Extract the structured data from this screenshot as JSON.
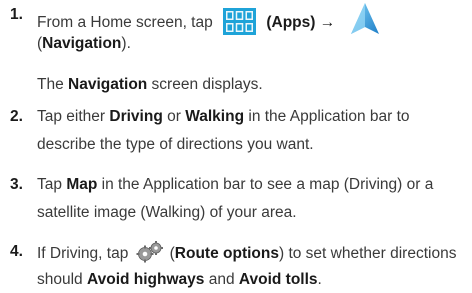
{
  "steps": [
    {
      "number": "1.",
      "line1": {
        "t1": "From a Home screen, tap",
        "bold1": "(Apps)",
        "arrow": "→"
      },
      "line2": {
        "t1": "(",
        "bold1": "Navigation",
        "t2": ")."
      },
      "line3": {
        "t1": "The ",
        "bold1": "Navigation",
        "t2": " screen displays."
      }
    },
    {
      "number": "2.",
      "line1": {
        "t1": "Tap either ",
        "bold1": "Driving",
        "t2": " or ",
        "bold2": "Walking",
        "t3": " in the Application bar to"
      },
      "line2": {
        "t1": "describe the type of directions you want."
      }
    },
    {
      "number": "3.",
      "line1": {
        "t1": "Tap ",
        "bold1": "Map",
        "t2": " in the Application bar to see a map (Driving) or a"
      },
      "line2": {
        "t1": "satellite image (Walking) of your area."
      }
    },
    {
      "number": "4.",
      "line1": {
        "t1": "If Driving, tap",
        "t2": "(",
        "bold1": "Route options",
        "t3": ") to set whether directions"
      },
      "line2": {
        "t1": "should ",
        "bold1": "Avoid highways",
        "t2": " and ",
        "bold2": "Avoid tolls",
        "t3": "."
      }
    }
  ],
  "icons": {
    "apps": "apps-grid-icon",
    "navigation": "navigation-arrow-icon",
    "route_options": "gear-icon"
  },
  "colors": {
    "apps_icon": "#1fa3d8",
    "navigation_icon": "#3aa0e0",
    "text": "#3a3a3a",
    "bold": "#1a1a1a"
  }
}
